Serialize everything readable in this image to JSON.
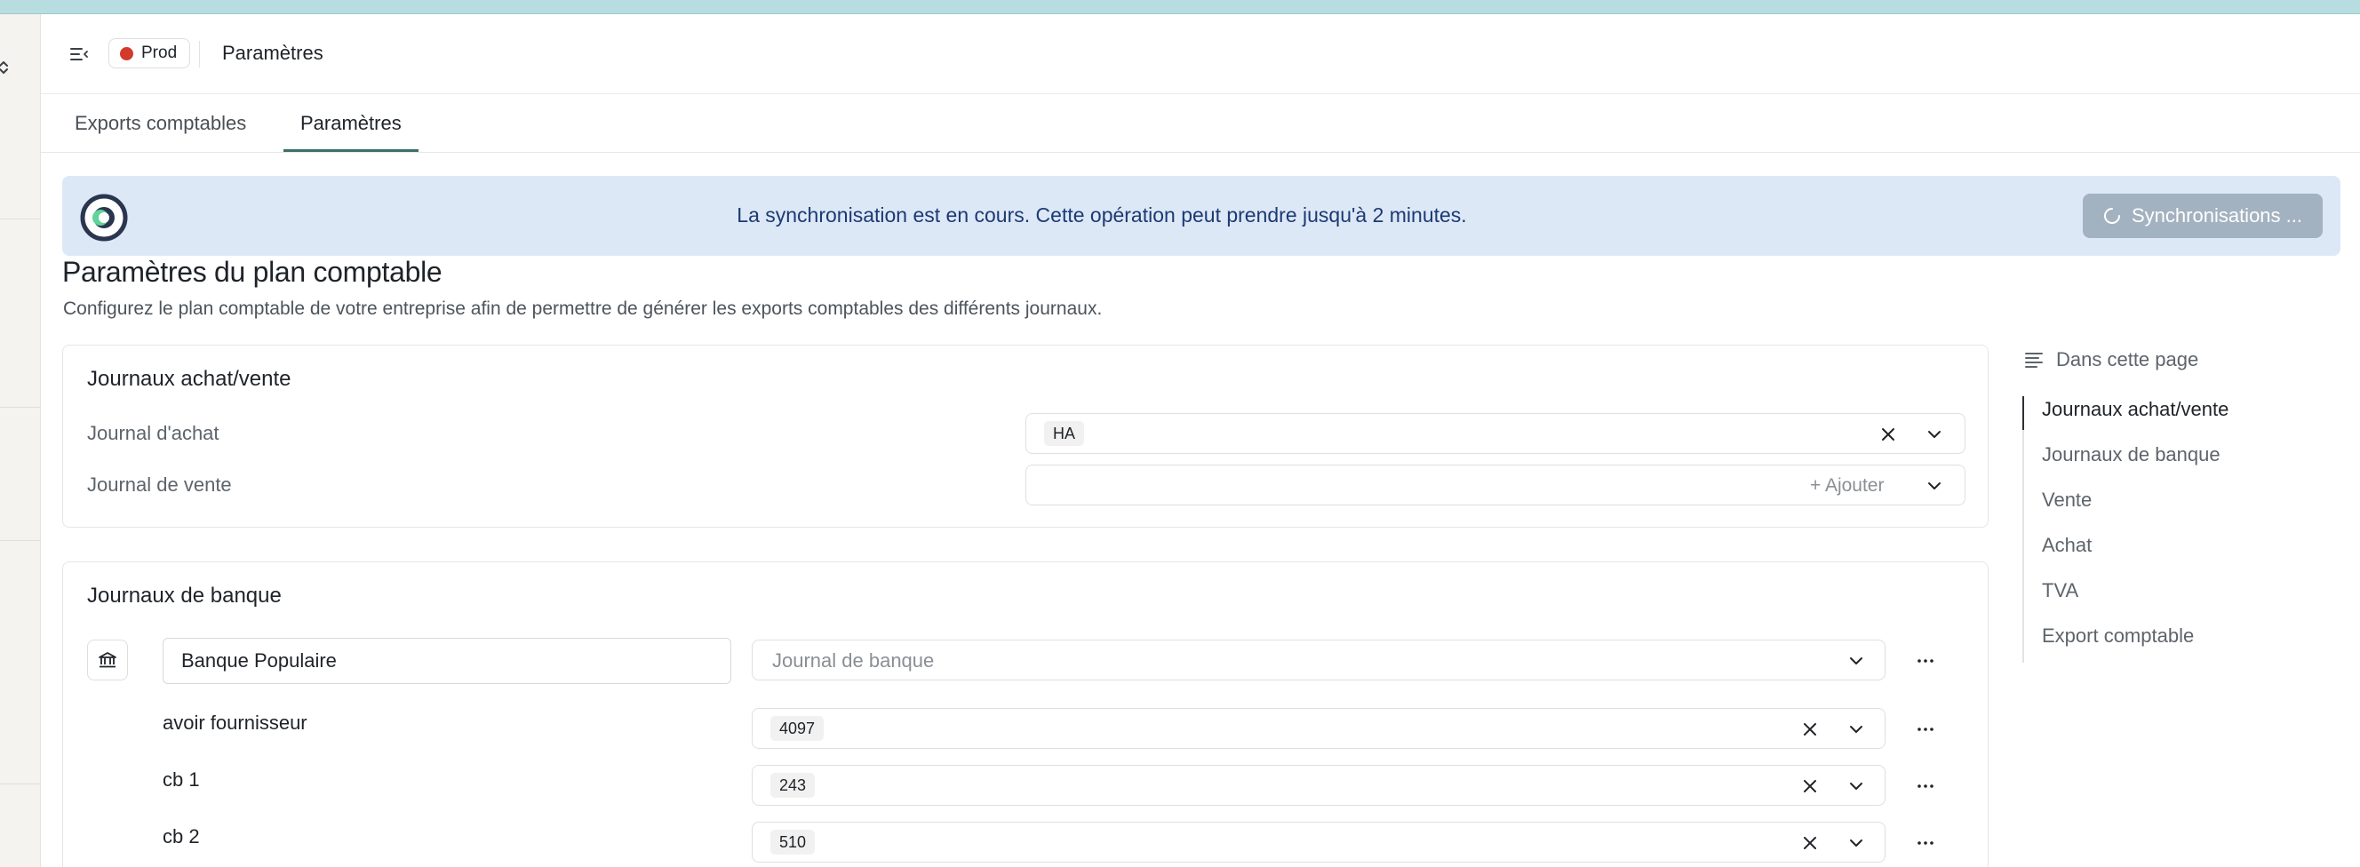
{
  "header": {
    "env_label": "Prod",
    "title": "Paramètres",
    "env_color": "#d23a2b"
  },
  "tabs": [
    {
      "label": "Exports comptables",
      "active": false
    },
    {
      "label": "Paramètres",
      "active": true
    }
  ],
  "sync_banner": {
    "message": "La synchronisation est en cours. Cette opération peut prendre jusqu'à 2 minutes.",
    "button_label": "Synchronisations ..."
  },
  "page": {
    "title": "Paramètres du plan comptable",
    "description": "Configurez le plan comptable de votre entreprise afin de permettre de générer les exports comptables des différents journaux."
  },
  "journaux_achat_vente": {
    "title": "Journaux achat/vente",
    "rows": [
      {
        "label": "Journal d'achat",
        "value": "HA"
      },
      {
        "label": "Journal de vente",
        "add_label": "+ Ajouter"
      }
    ]
  },
  "journaux_banque": {
    "title": "Journaux de banque",
    "bank_name": "Banque Populaire",
    "journal_placeholder": "Journal de banque",
    "accounts": [
      {
        "label": "avoir fournisseur",
        "value": "4097"
      },
      {
        "label": "cb 1",
        "value": "243"
      },
      {
        "label": "cb 2",
        "value": "510"
      }
    ]
  },
  "toc": {
    "heading": "Dans cette page",
    "items": [
      {
        "label": "Journaux achat/vente",
        "active": true
      },
      {
        "label": "Journaux de banque",
        "active": false
      },
      {
        "label": "Vente",
        "active": false
      },
      {
        "label": "Achat",
        "active": false
      },
      {
        "label": "TVA",
        "active": false
      },
      {
        "label": "Export comptable",
        "active": false
      }
    ]
  },
  "icons": {
    "left_rail": "chevron-up-down-icon",
    "header": "sidebar-collapse-icon",
    "banner": "sync-logo-icon",
    "sync_button": "spinner-icon",
    "clear": "close-icon",
    "dropdown": "chevron-down-icon",
    "bank": "bank-icon",
    "more": "more-horizontal-icon",
    "toc": "list-icon"
  }
}
